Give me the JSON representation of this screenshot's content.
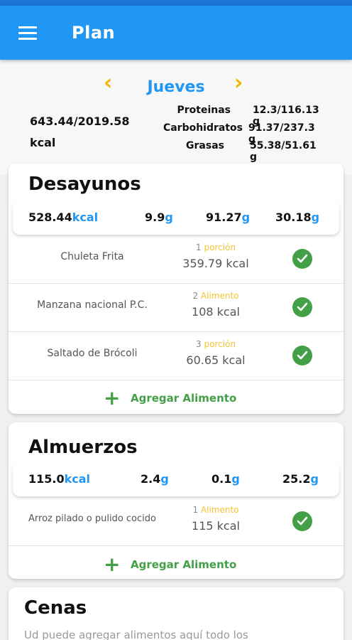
{
  "app": {
    "title": "Plan",
    "menu_icon": "hamburger-menu-icon"
  },
  "day": {
    "label": "Jueves",
    "prev_icon": "chevron-left-icon",
    "next_icon": "chevron-right-icon"
  },
  "summary": {
    "kcal_value": "643.44/2019.58",
    "kcal_unit": "kcal",
    "macros": [
      {
        "name": "Proteinas",
        "value": "12.3/116.13 g"
      },
      {
        "name": "Carbohidratos",
        "value": "91.37/237.3 g"
      },
      {
        "name": "Grasas",
        "value": "55.38/51.61 g"
      }
    ]
  },
  "meals": [
    {
      "title": "Desayunos",
      "totals": {
        "kcal": "528.44",
        "kcal_unit": "kcal",
        "protein": "9.9",
        "carbs": "91.27",
        "fat": "30.18",
        "gram_unit": "g"
      },
      "foods": [
        {
          "name": "Chuleta Frita",
          "qty": "1",
          "unit": "porción",
          "kcal": "359.79 kcal",
          "done": true
        },
        {
          "name": "Manzana nacional P.C.",
          "qty": "2",
          "unit": "Alimento",
          "kcal": "108 kcal",
          "done": true
        },
        {
          "name": "Saltado de Brócoli",
          "qty": "3",
          "unit": "porción",
          "kcal": "60.65 kcal",
          "done": true
        }
      ],
      "add_label": "Agregar Alimento"
    },
    {
      "title": "Almuerzos",
      "totals": {
        "kcal": "115.0",
        "kcal_unit": "kcal",
        "protein": "2.4",
        "carbs": "0.1",
        "fat": "25.2",
        "gram_unit": "g"
      },
      "foods": [
        {
          "name": "Arroz pilado o pulido cocido",
          "qty": "1",
          "unit": "Alimento",
          "kcal": "115 kcal",
          "done": true
        }
      ],
      "add_label": "Agregar Alimento"
    },
    {
      "title": "Cenas",
      "note": "Ud puede agregar alimentos aquí todo los"
    }
  ],
  "colors": {
    "primary": "#2196f3",
    "accent": "#f4b400",
    "success": "#43a047"
  }
}
